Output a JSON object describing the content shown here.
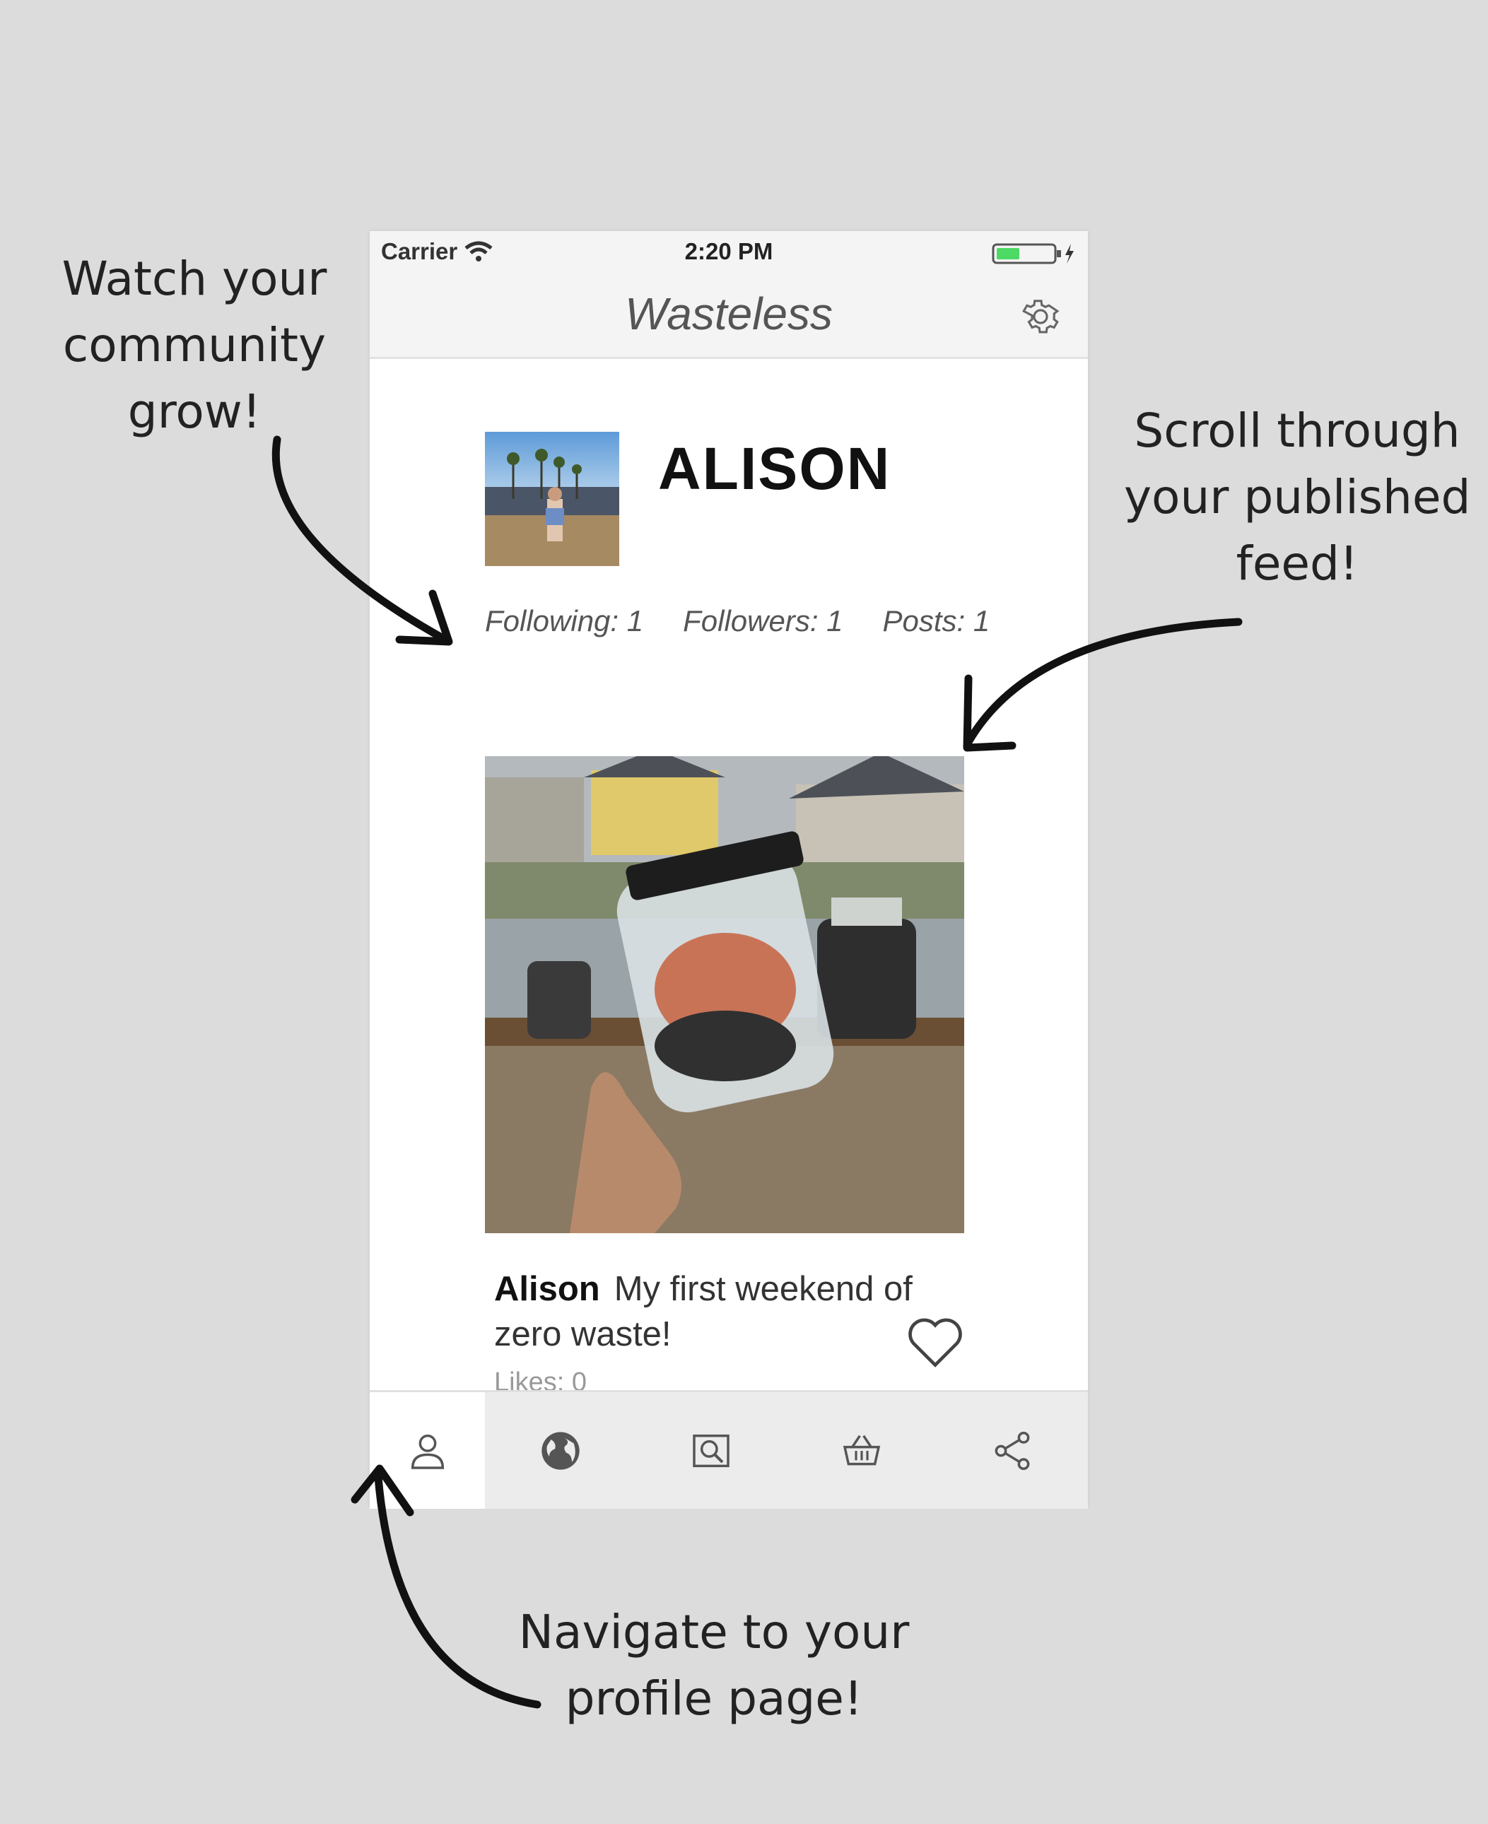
{
  "annotations": {
    "community": [
      "Watch your",
      "community",
      "grow!"
    ],
    "feed": [
      "Scroll through",
      "your published",
      "feed!"
    ],
    "profile": [
      "Navigate to your",
      "profile page!"
    ]
  },
  "status_bar": {
    "carrier": "Carrier",
    "time": "2:20 PM",
    "battery_color": "#4cd964"
  },
  "header": {
    "title": "Wasteless",
    "settings_icon": "gear-icon"
  },
  "profile": {
    "name": "ALISON",
    "stats": [
      {
        "label": "Following: 1"
      },
      {
        "label": "Followers: 1"
      },
      {
        "label": "Posts: 1"
      }
    ]
  },
  "post": {
    "author": "Alison",
    "text": "My first weekend of zero waste!",
    "likes": "Likes: 0",
    "like_icon": "heart-icon"
  },
  "tabbar": {
    "tabs": [
      {
        "icon": "profile-icon",
        "active": true
      },
      {
        "icon": "globe-icon",
        "active": false
      },
      {
        "icon": "search-photo-icon",
        "active": false
      },
      {
        "icon": "basket-icon",
        "active": false
      },
      {
        "icon": "share-icon",
        "active": false
      }
    ]
  }
}
